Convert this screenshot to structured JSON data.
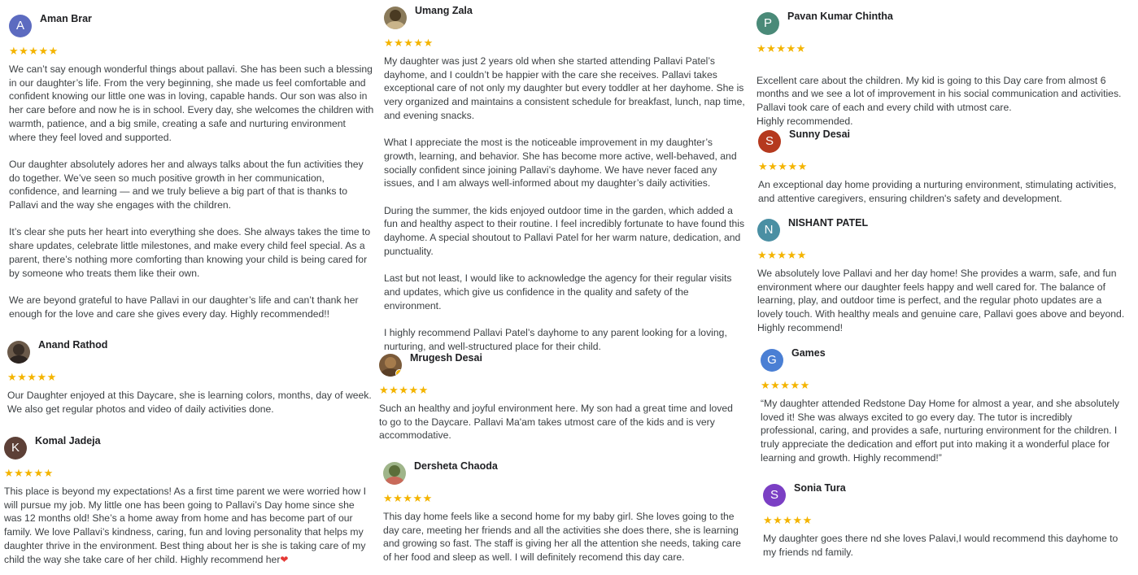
{
  "stars": "★★★★★",
  "reviews": {
    "aman": {
      "name": "Aman Brar",
      "initial": "A",
      "color": "#5c6bc0",
      "paragraphs": [
        "We can’t say enough wonderful things about pallavi. She has been such a blessing in our daughter’s life. From the very beginning, she made us feel comfortable and confident knowing our little one was in loving, capable hands. Our son was also in her care before and now he is in school. Every day, she welcomes the children with warmth, patience, and a big smile, creating a safe and nurturing environment where they feel loved and supported.",
        "Our daughter absolutely adores her and always talks about the fun activities they do together. We’ve seen so much positive growth in her communication, confidence, and learning — and we truly believe a big part of that is thanks to Pallavi and the way she engages with the children.",
        "It’s clear she puts her heart into everything she does. She always takes the time to share updates, celebrate little milestones, and make every child feel special. As a parent, there’s nothing more comforting than knowing your child is being cared for by someone who treats them like their own.",
        "We are beyond grateful to have Pallavi in our daughter’s life and can’t thank her enough for the love and care she gives every day. Highly recommended!!"
      ]
    },
    "anand": {
      "name": "Anand Rathod",
      "paragraphs": [
        "Our Daughter enjoyed at this Daycare, she is learning colors, months, day of week. We also get regular photos and video of daily activities done."
      ]
    },
    "komal": {
      "name": "Komal Jadeja",
      "initial": "K",
      "color": "#5d4037",
      "paragraphs": [
        "This place is beyond my expectations! As a first time parent we were worried how I will pursue my job. My little one has been going to Pallavi’s Day home since she was 12 months old! She’s a home away from home and has become part of our family. We love Pallavi’s kindness, caring, fun and loving personality that helps my daughter thrive in the environment. Best thing about her is she is taking care of my child the way she take care of her child. Highly recommend her"
      ]
    },
    "umang": {
      "name": "Umang Zala",
      "paragraphs": [
        "My daughter was just 2 years old when she started attending Pallavi Patel’s dayhome, and I couldn’t be happier with the care she receives. Pallavi takes exceptional care of not only my daughter but every toddler at her dayhome. She is very organized and maintains a consistent schedule for breakfast, lunch, nap time, and evening snacks.",
        "What I appreciate the most is the noticeable improvement in my daughter’s growth, learning, and behavior. She has become more active, well-behaved, and socially confident since joining Pallavi’s dayhome. We have never faced any issues, and I am always well-informed about my daughter’s daily activities.",
        "During the summer, the kids enjoyed outdoor time in the garden, which added a fun and healthy aspect to their routine. I feel incredibly fortunate to have found this dayhome. A special shoutout to Pallavi Patel for her warm nature, dedication, and punctuality.",
        "Last but not least, I would like to acknowledge the agency for their regular visits and updates, which give us confidence in the quality and safety of the environment.",
        "I highly recommend Pallavi Patel’s dayhome to any parent looking for a loving, nurturing, and well-structured place for their child."
      ]
    },
    "mrugesh": {
      "name": "Mrugesh Desai",
      "paragraphs": [
        "Such an healthy and joyful environment here. My son had a great time and loved to go to the Daycare. Pallavi Ma'am takes utmost care of the kids and is very accommodative."
      ]
    },
    "dersheta": {
      "name": "Dersheta Chaoda",
      "paragraphs": [
        "This day home feels like a second home for my baby girl. She loves going to the day care, meeting her friends and all the activities she does there, she is learning and growing so fast. The staff is giving her all the attention she needs, taking care of her food and sleep as well. I will definitely recomend this day care."
      ]
    },
    "pavan": {
      "name": "Pavan Kumar Chintha",
      "initial": "P",
      "color": "#4a8a78",
      "paragraphs": [
        "Excellent care about the children. My kid is going to this Day care from almost 6 months and we see a lot of improvement in his social communication and activities. Pallavi took care of each and every child with utmost care.\nHighly recommended."
      ]
    },
    "sunny": {
      "name": "Sunny Desai",
      "initial": "S",
      "color": "#b5391e",
      "paragraphs": [
        "An exceptional day home providing a nurturing environment, stimulating activities, and attentive caregivers, ensuring children's safety and development."
      ]
    },
    "nishant": {
      "name": "NISHANT PATEL",
      "initial": "N",
      "color": "#4a8fa3",
      "paragraphs": [
        "We absolutely love Pallavi and her day home! She provides a warm, safe, and fun environment where our daughter feels happy and well cared for. The balance of learning, play, and outdoor time is perfect, and the regular photo updates are a lovely touch. With healthy meals and genuine care, Pallavi goes above and beyond. Highly recommend!"
      ]
    },
    "games": {
      "name": "Games",
      "initial": "G",
      "color": "#4a7fd4",
      "paragraphs": [
        "“My daughter attended Redstone Day Home for almost a year, and she absolutely loved it! She was always excited to go every day. The tutor is incredibly professional, caring, and provides a safe, nurturing environment for the children. I truly appreciate the dedication and effort put into making it a wonderful place for learning and growth. Highly recommend!”"
      ]
    },
    "sonia": {
      "name": "Sonia Tura",
      "initial": "S",
      "color": "#7b3fc4",
      "paragraphs": [
        "My daughter goes there nd she loves Palavi,I would recommend this dayhome to my friends nd family."
      ]
    }
  }
}
